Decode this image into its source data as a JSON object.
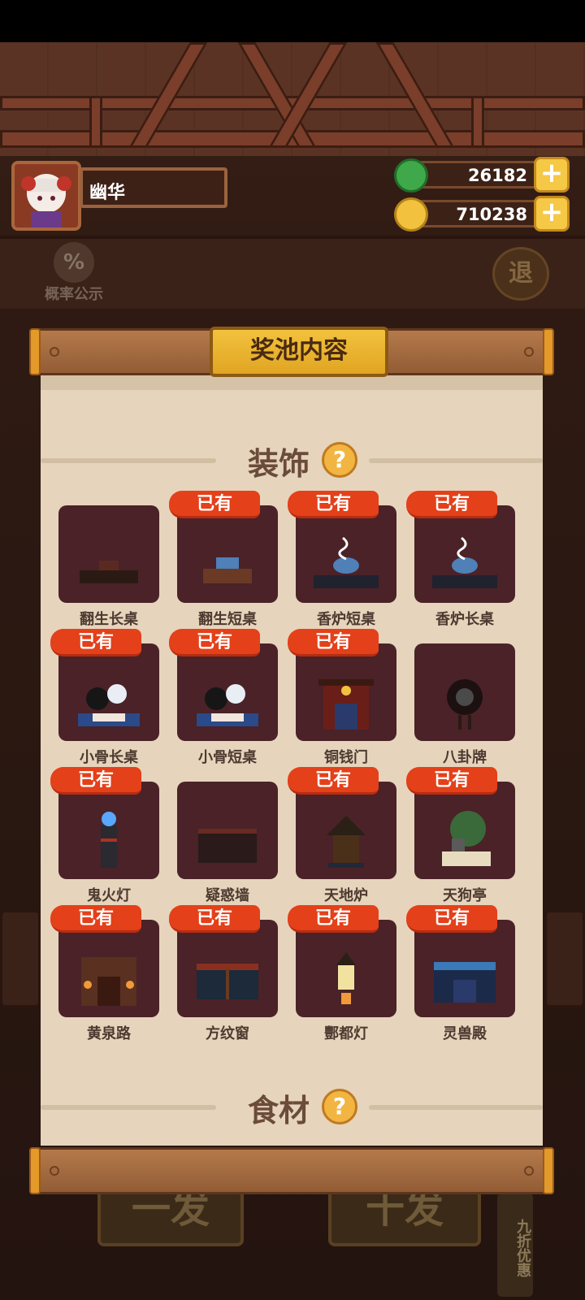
{
  "player": {
    "name": "幽华"
  },
  "currencies": [
    {
      "icon": "jade-coin-icon",
      "value": "26182",
      "color": "#3fa84a"
    },
    {
      "icon": "gold-coin-icon",
      "value": "710238",
      "color": "#f2c23e"
    }
  ],
  "hud": {
    "rate_label": "概率公示",
    "rate_icon": "%",
    "exit_label": "退"
  },
  "bottom": {
    "single_draw": "一发",
    "ten_draw": "十发",
    "discount": "九折优惠"
  },
  "panel": {
    "title": "奖池内容",
    "owned_badge": "已有",
    "sections": [
      {
        "label": "装饰",
        "help": "?",
        "items": [
          {
            "name": "翻生长桌",
            "owned": false,
            "art": "long-table"
          },
          {
            "name": "翻生短桌",
            "owned": true,
            "art": "short-table"
          },
          {
            "name": "香炉短桌",
            "owned": true,
            "art": "incense-short"
          },
          {
            "name": "香炉长桌",
            "owned": true,
            "art": "incense-long"
          },
          {
            "name": "小骨长桌",
            "owned": true,
            "art": "bone-long"
          },
          {
            "name": "小骨短桌",
            "owned": true,
            "art": "bone-short"
          },
          {
            "name": "铜钱门",
            "owned": true,
            "art": "coin-gate"
          },
          {
            "name": "八卦牌",
            "owned": false,
            "art": "bagua"
          },
          {
            "name": "鬼火灯",
            "owned": true,
            "art": "ghost-lamp"
          },
          {
            "name": "疑惑墙",
            "owned": false,
            "art": "wall"
          },
          {
            "name": "天地炉",
            "owned": true,
            "art": "furnace"
          },
          {
            "name": "天狗亭",
            "owned": true,
            "art": "pavilion"
          },
          {
            "name": "黄泉路",
            "owned": true,
            "art": "gate"
          },
          {
            "name": "方纹窗",
            "owned": true,
            "art": "window"
          },
          {
            "name": "酆都灯",
            "owned": true,
            "art": "lantern"
          },
          {
            "name": "灵兽殿",
            "owned": true,
            "art": "hall"
          }
        ]
      },
      {
        "label": "食材",
        "help": "?"
      }
    ]
  }
}
